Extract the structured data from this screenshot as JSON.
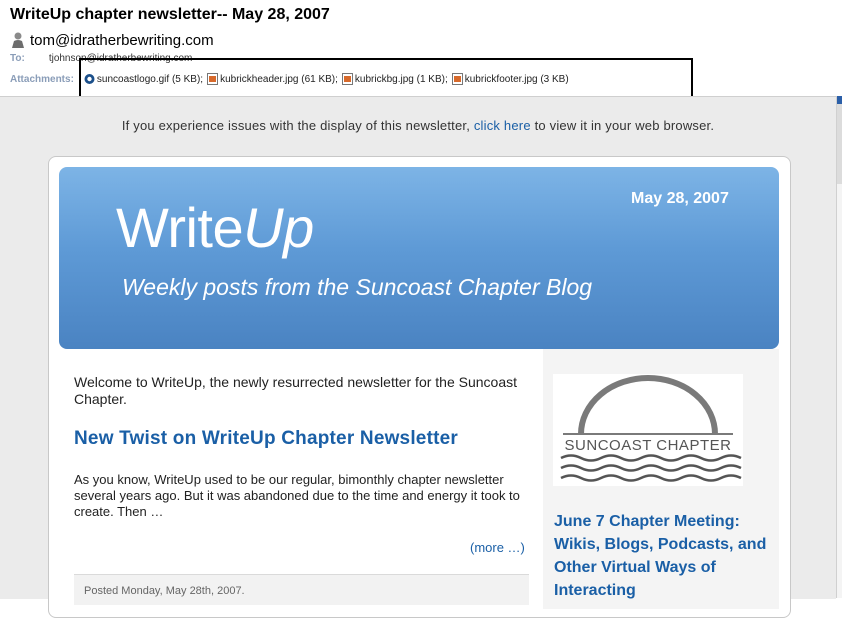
{
  "email": {
    "subject": "WriteUp chapter newsletter-- May 28, 2007",
    "from": "tom@idratherbewriting.com",
    "to_label": "To:",
    "to": "tjohnson@idratherbewriting.com",
    "attachments_label": "Attachments:",
    "attachments": [
      {
        "name": "suncoastlogo.gif (5 KB);",
        "icon": "gif-file-icon"
      },
      {
        "name": "kubrickheader.jpg (61 KB);",
        "icon": "image-file-icon"
      },
      {
        "name": "kubrickbg.jpg (1 KB);",
        "icon": "image-file-icon"
      },
      {
        "name": "kubrickfooter.jpg (3 KB)",
        "icon": "image-file-icon"
      }
    ]
  },
  "notice": {
    "before": "If you experience issues with the display of this newsletter,",
    "link": "click here",
    "after": "to view it in your web browser."
  },
  "banner": {
    "title_main": "Write",
    "title_italic": "Up",
    "date": "May 28, 2007",
    "subtitle": "Weekly posts from the Suncoast Chapter Blog"
  },
  "main": {
    "welcome": "Welcome to WriteUp, the newly resurrected newsletter for the Suncoast Chapter.",
    "post_title": "New Twist on WriteUp Chapter Newsletter",
    "post_excerpt": "As you know, WriteUp used to be our regular, bimonthly chapter newsletter several years ago. But it was abandoned due to the time and energy it took to create. Then …",
    "more_link": "(more …)",
    "posted": "Posted Monday, May 28th, 2007."
  },
  "sidebar": {
    "logo_text": "SUNCOAST CHAPTER",
    "link": "June 7 Chapter Meeting: Wikis, Blogs, Podcasts, and Other Virtual Ways of Interacting"
  },
  "colors": {
    "link_blue": "#1a5fa6",
    "banner_blue": "#5e9ad6",
    "header_label": "#8a9db8"
  }
}
